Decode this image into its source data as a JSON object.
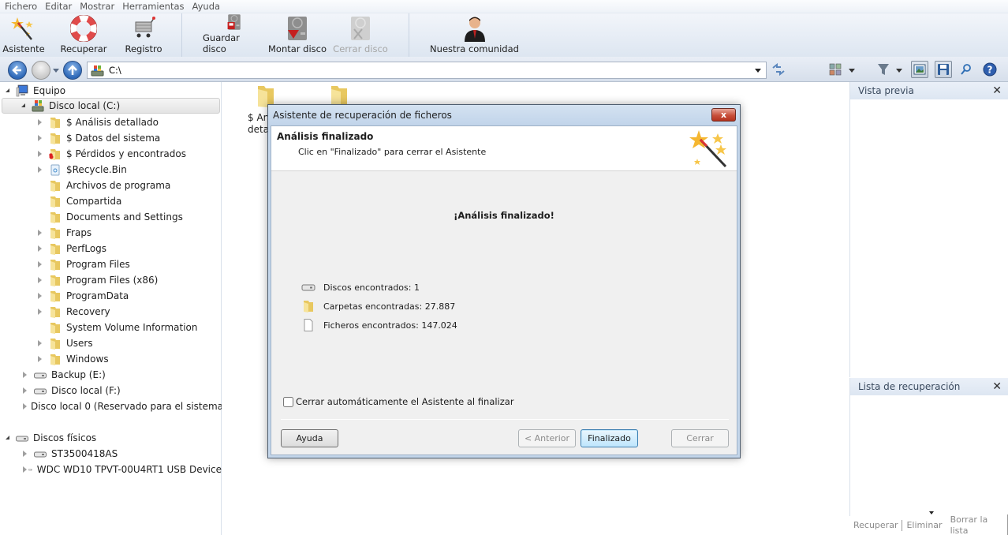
{
  "menu": [
    "Fichero",
    "Editar",
    "Mostrar",
    "Herramientas",
    "Ayuda"
  ],
  "toolbar": {
    "asistente": "Asistente",
    "recuperar": "Recuperar",
    "registro": "Registro",
    "guardar_disco": "Guardar disco",
    "montar_disco": "Montar disco",
    "cerrar_disco": "Cerrar disco",
    "comunidad": "Nuestra comunidad"
  },
  "address": {
    "value": "C:\\"
  },
  "tree": {
    "root": "Equipo",
    "drive_c": "Disco local (C:)",
    "folders": [
      {
        "label": "$ Análisis detallado",
        "expandable": true,
        "icon": "folder-icon"
      },
      {
        "label": "$ Datos del sistema",
        "expandable": true,
        "icon": "folder-icon"
      },
      {
        "label": "$ Pérdidos y encontrados",
        "expandable": true,
        "icon": "lost-folder-icon"
      },
      {
        "label": "$Recycle.Bin",
        "expandable": true,
        "icon": "recycle-bin-icon"
      },
      {
        "label": "Archivos de programa",
        "expandable": false,
        "icon": "folder-icon"
      },
      {
        "label": "Compartida",
        "expandable": false,
        "icon": "folder-icon"
      },
      {
        "label": "Documents and Settings",
        "expandable": false,
        "icon": "folder-icon"
      },
      {
        "label": "Fraps",
        "expandable": true,
        "icon": "folder-icon"
      },
      {
        "label": "PerfLogs",
        "expandable": true,
        "icon": "folder-icon"
      },
      {
        "label": "Program Files",
        "expandable": true,
        "icon": "folder-icon"
      },
      {
        "label": "Program Files (x86)",
        "expandable": true,
        "icon": "folder-icon"
      },
      {
        "label": "ProgramData",
        "expandable": true,
        "icon": "folder-icon"
      },
      {
        "label": "Recovery",
        "expandable": true,
        "icon": "folder-icon"
      },
      {
        "label": "System Volume Information",
        "expandable": false,
        "icon": "folder-icon"
      },
      {
        "label": "Users",
        "expandable": true,
        "icon": "folder-icon"
      },
      {
        "label": "Windows",
        "expandable": true,
        "icon": "folder-icon"
      }
    ],
    "drives": [
      "Backup (E:)",
      "Disco local (F:)",
      "Disco local 0 (Reservado para el sistema)"
    ],
    "physical_root": "Discos físicos",
    "physical": [
      "ST3500418AS",
      "WDC WD10 TPVT-00U4RT1 USB Device"
    ]
  },
  "middle": {
    "item1_line1": "$ An",
    "item1_line2": "deta"
  },
  "right": {
    "preview_title": "Vista previa",
    "list_title": "Lista de recuperación",
    "footer": [
      "Recuperar",
      "Eliminar",
      "Borrar la lista"
    ]
  },
  "dialog": {
    "title": "Asistente de recuperación de ficheros",
    "close_label": "x",
    "header_title": "Análisis finalizado",
    "header_sub": "Clic en \"Finalizado\" para cerrar el Asistente",
    "big_message": "¡Análisis finalizado!",
    "stats": [
      {
        "label": "Discos encontrados: 1",
        "icon": "disk-icon"
      },
      {
        "label": "Carpetas encontradas: 27.887",
        "icon": "folder-icon"
      },
      {
        "label": "Ficheros encontrados: 147.024",
        "icon": "file-icon"
      }
    ],
    "auto_close_label": "Cerrar automáticamente el Asistente al finalizar",
    "auto_close_checked": false,
    "buttons": {
      "help": "Ayuda",
      "back": "< Anterior",
      "finish": "Finalizado",
      "close": "Cerrar"
    }
  }
}
